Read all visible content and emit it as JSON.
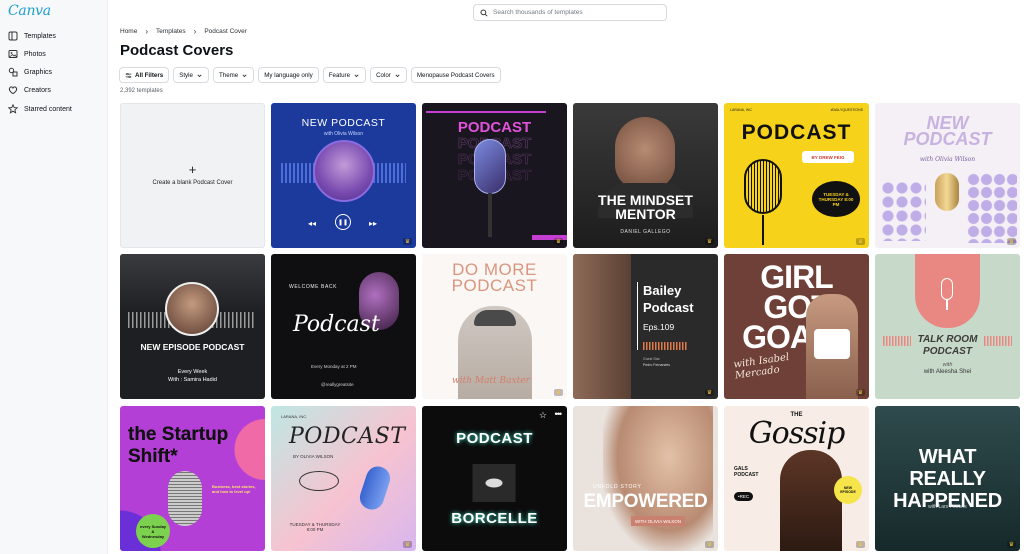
{
  "app": {
    "logo": "Canva"
  },
  "sidebar": {
    "items": [
      {
        "label": "Templates",
        "icon": "templates-icon"
      },
      {
        "label": "Photos",
        "icon": "photos-icon"
      },
      {
        "label": "Graphics",
        "icon": "graphics-icon"
      },
      {
        "label": "Creators",
        "icon": "creators-icon"
      },
      {
        "label": "Starred content",
        "icon": "star-icon"
      }
    ]
  },
  "search": {
    "placeholder": "Search thousands of templates"
  },
  "breadcrumb": [
    "Home",
    "Templates",
    "Podcast Cover"
  ],
  "page_title": "Podcast Covers",
  "filters": [
    {
      "label": "All Filters"
    },
    {
      "label": "Style"
    },
    {
      "label": "Theme"
    },
    {
      "label": "My language only"
    },
    {
      "label": "Feature"
    },
    {
      "label": "Color"
    },
    {
      "label": "Menopause Podcast Covers"
    }
  ],
  "template_count": "2,392 templates",
  "blank_tile": {
    "label": "Create a blank Podcast Cover"
  },
  "templates": [
    {
      "title": "NEW PODCAST",
      "subtitle": "with Olivia Wilson"
    },
    {
      "title": "PODCAST",
      "subtitle": ""
    },
    {
      "title": "THE MINDSET MENTOR",
      "subtitle": "DANIEL GALLEGO"
    },
    {
      "title": "PODCAST",
      "subtitle": "BY DREW FEIG",
      "extra": "TUESDAY & THURSDAY 8:00 PM",
      "top_left": "LARANA, INC",
      "top_right": "#DAILYQUESTIONS"
    },
    {
      "title": "NEW PODCAST",
      "subtitle": "with Olivia Wilson"
    },
    {
      "title": "NEW EPISODE PODCAST",
      "subtitle": "Every Week",
      "extra": "With : Samira Hadid"
    },
    {
      "title": "Podcast",
      "subtitle": "WELCOME BACK",
      "extra": "Every Monday at 2 PM",
      "handle": "@reallygreatsite"
    },
    {
      "title": "DO MORE PODCAST",
      "subtitle": "with Matt Baxter"
    },
    {
      "title": "Bailey Podcast",
      "subtitle": "Eps.109",
      "extra": "Pedro Fernandes",
      "host_label": "Guest Star"
    },
    {
      "title": "GIRL GOT GOALS",
      "subtitle": "with Isabel Mercado"
    },
    {
      "title": "TALK ROOM PODCAST",
      "subtitle": "with Aleesha Shei"
    },
    {
      "title": "the Startup Shift*",
      "subtitle": "every Sunday & Wednesday",
      "extra": "Business, best stories, and how to level up!"
    },
    {
      "title": "PODCAST",
      "subtitle": "BY OLIVIA WILSON",
      "extra": "TUESDAY & THURSDAY 8:00 PM",
      "top_left": "LARANA, INC."
    },
    {
      "title": "PODCAST",
      "subtitle": "BORCELLE"
    },
    {
      "title": "EMPOWERED",
      "subtitle": "UNFOLD STORY",
      "extra": "WITH OLIVIA WILSON"
    },
    {
      "title": "Gossip",
      "subtitle": "GALS PODCAST",
      "extra": "•REC",
      "top": "THE",
      "badge": "NEW EPISODE"
    },
    {
      "title": "WHAT REALLY HAPPENED",
      "subtitle": "with Lars Peeters"
    }
  ]
}
